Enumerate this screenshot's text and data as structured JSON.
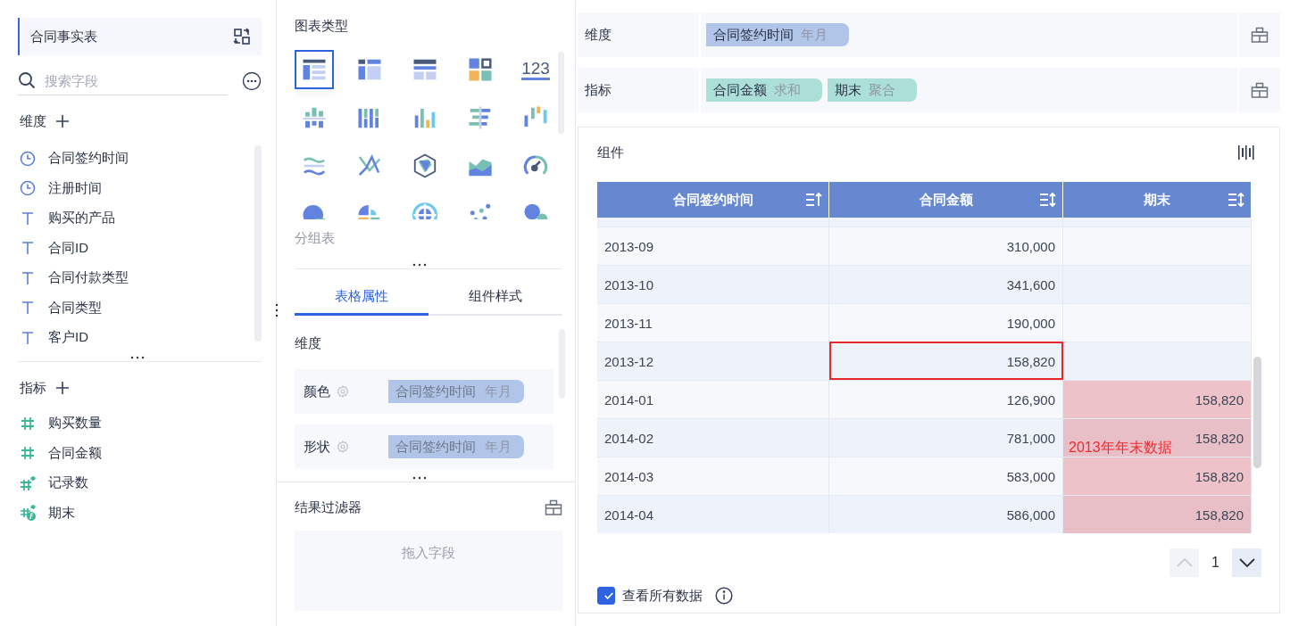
{
  "left_panel": {
    "table_name": "合同事实表",
    "search": {
      "placeholder": "搜索字段"
    },
    "dimensions_title": "维度",
    "dimension_fields": [
      {
        "name": "合同签约时间",
        "kind": "date"
      },
      {
        "name": "注册时间",
        "kind": "date"
      },
      {
        "name": "购买的产品",
        "kind": "text"
      },
      {
        "name": "合同ID",
        "kind": "text"
      },
      {
        "name": "合同付款类型",
        "kind": "text"
      },
      {
        "name": "合同类型",
        "kind": "text"
      },
      {
        "name": "客户ID",
        "kind": "text"
      }
    ],
    "measures_title": "指标",
    "measure_fields": [
      {
        "name": "购买数量",
        "kind": "number"
      },
      {
        "name": "合同金额",
        "kind": "number"
      },
      {
        "name": "记录数",
        "kind": "count"
      },
      {
        "name": "期末",
        "kind": "calc"
      }
    ]
  },
  "middle_panel": {
    "chart_types_title": "图表类型",
    "chart_types": [
      {
        "selected": true
      },
      {
        "selected": false
      },
      {
        "selected": false
      },
      {
        "selected": false
      },
      {
        "selected": false,
        "text": "123"
      },
      {
        "selected": false
      },
      {
        "selected": false
      },
      {
        "selected": false
      },
      {
        "selected": false
      },
      {
        "selected": false
      },
      {
        "selected": false
      },
      {
        "selected": false
      },
      {
        "selected": false
      },
      {
        "selected": false
      },
      {
        "selected": false
      },
      {
        "selected": false
      },
      {
        "selected": false
      },
      {
        "selected": false
      },
      {
        "selected": false
      },
      {
        "selected": false
      }
    ],
    "chart_type_name": "分组表",
    "tabs": [
      {
        "label": "表格属性",
        "selected": true
      },
      {
        "label": "组件样式",
        "selected": false
      }
    ],
    "section_title": "维度",
    "properties": [
      {
        "label": "颜色",
        "field": "合同签约时间",
        "aggregation": "年月"
      },
      {
        "label": "形状",
        "field": "合同签约时间",
        "aggregation": "年月"
      }
    ],
    "filter_title": "结果过滤器",
    "filter_placeholder": "拖入字段"
  },
  "right_panel": {
    "dimension": {
      "label": "维度",
      "pills": [
        {
          "field": "合同签约时间",
          "aggregation": "年月",
          "kind": "dimension"
        }
      ]
    },
    "measure": {
      "label": "指标",
      "pills": [
        {
          "field": "合同金额",
          "aggregation": "求和",
          "kind": "measure"
        },
        {
          "field": "期末",
          "aggregation": "聚合",
          "kind": "measure"
        }
      ]
    },
    "component": {
      "title": "组件",
      "columns": [
        {
          "label": "合同签约时间",
          "sorted_ascending": true
        },
        {
          "label": "合同金额",
          "sorted_ascending": false
        },
        {
          "label": "期末",
          "sorted_ascending": false
        }
      ],
      "rows": [
        {
          "month": "2013-09",
          "amount": "310,000",
          "outlined": false,
          "highlighted": false
        },
        {
          "month": "2013-10",
          "amount": "341,600",
          "outlined": false,
          "highlighted": false
        },
        {
          "month": "2013-11",
          "amount": "190,000",
          "outlined": false,
          "highlighted": false
        },
        {
          "month": "2013-12",
          "amount": "158,820",
          "outlined": true,
          "highlighted": false
        },
        {
          "month": "2014-01",
          "amount": "126,900",
          "period_end": "158,820",
          "outlined": false,
          "highlighted": true
        },
        {
          "month": "2014-02",
          "amount": "781,000",
          "period_end": "158,820",
          "outlined": false,
          "highlighted": true
        },
        {
          "month": "2014-03",
          "amount": "583,000",
          "period_end": "158,820",
          "outlined": false,
          "highlighted": true
        },
        {
          "month": "2014-04",
          "amount": "586,000",
          "period_end": "158,820",
          "outlined": false,
          "highlighted": true
        }
      ],
      "annotation": "2013年年末数据",
      "pagination": {
        "page": "1",
        "prev_disabled": true,
        "next_disabled": false
      },
      "show_all": {
        "label": "查看所有数据",
        "checked": true
      }
    }
  }
}
